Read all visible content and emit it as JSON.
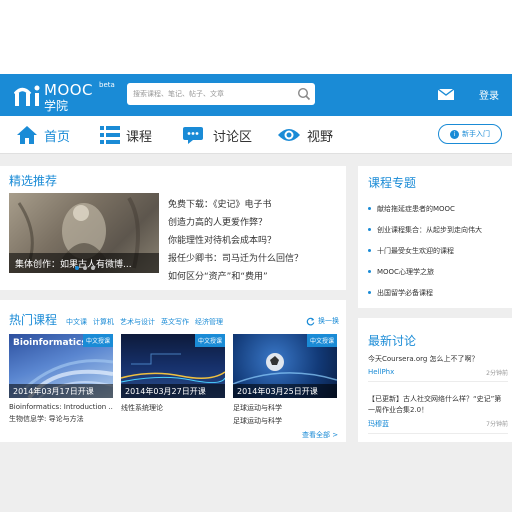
{
  "header": {
    "logo_text": "MOOC",
    "logo_beta": "beta",
    "logo_cn": "学院",
    "search_placeholder": "搜索课程、笔记、帖子、文章",
    "login_label": "登录"
  },
  "nav": {
    "items": [
      {
        "label": "首页",
        "icon": "home-icon"
      },
      {
        "label": "课程",
        "icon": "course-list-icon"
      },
      {
        "label": "讨论区",
        "icon": "discussion-icon"
      },
      {
        "label": "视野",
        "icon": "eye-icon"
      }
    ],
    "newbie_label": "新手入门"
  },
  "featured": {
    "title": "精选推荐",
    "slide_caption": "集体创作：如果古人有微博...",
    "links": [
      "免费下载：《史记》电子书",
      "创造力高的人更爱作弊？",
      "你能理性对待机会成本吗？",
      "报任少卿书：司马迁为什么回信？",
      "如何区分“资产”和“费用”"
    ]
  },
  "hot": {
    "title": "热门课程",
    "tags": [
      "中文课",
      "计算机",
      "艺术与设计",
      "英文写作",
      "经济管理"
    ],
    "refresh_label": "换一换",
    "courses": [
      {
        "badge": "中文授课",
        "date": "2014年03月17日开课",
        "title": "Bioinformatics: Introduction ...",
        "subtitle": "生物信息学: 导论与方法",
        "thumb_text": "Bioinformatics"
      },
      {
        "badge": "中文授课",
        "date": "2014年03月27日开课",
        "title": "线性系统理论",
        "subtitle": ""
      },
      {
        "badge": "中文授课",
        "date": "2014年03月25日开课",
        "title": "足球运动与科学",
        "subtitle": "足球运动与科学"
      }
    ],
    "see_all": "查看全部 >"
  },
  "topics": {
    "title": "课程专题",
    "items": [
      "献给拖延症患者的MOOC",
      "创业课程集合：从起步到走向伟大",
      "十门最受女生欢迎的课程",
      "MOOC心理学之旅",
      "出国留学必备课程"
    ]
  },
  "discussions": {
    "title": "最新讨论",
    "items": [
      {
        "question": "今天Coursera.org 怎么上不了啊？",
        "user": "HellPhx",
        "time": "2分钟前"
      },
      {
        "question": "【已更新】古人社交网络什么样？“史记”第一周作业合集2.0！",
        "user": "玛穆蓝",
        "time": "7分钟前"
      }
    ]
  },
  "colors": {
    "accent": "#1a8bd6",
    "background": "#eeeeee"
  }
}
